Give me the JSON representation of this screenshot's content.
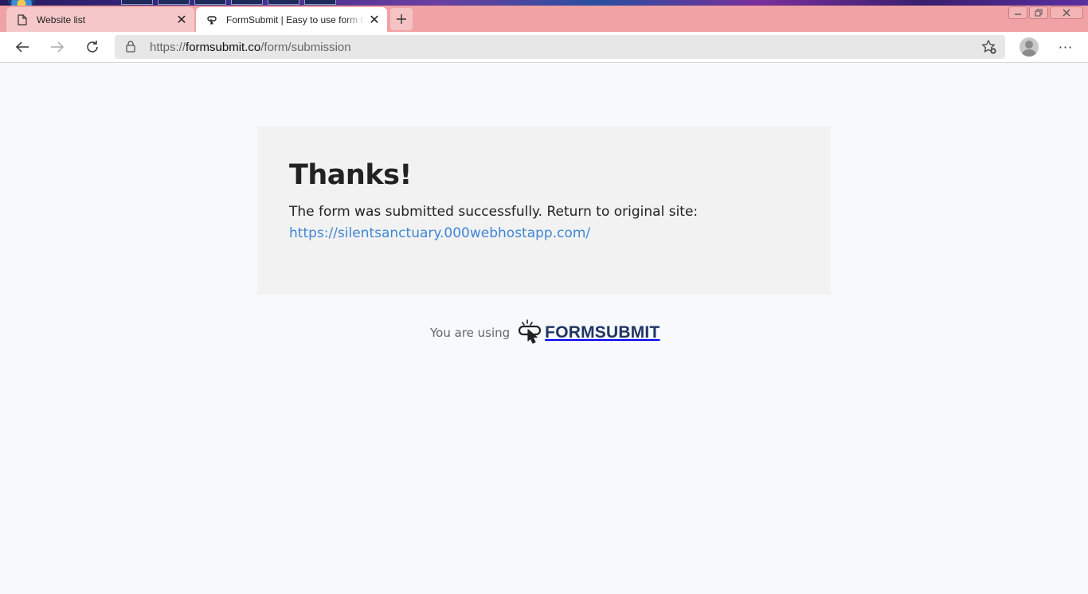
{
  "browser": {
    "tabs": [
      {
        "title": "Website list",
        "icon": "document-icon",
        "active": false
      },
      {
        "title": "FormSubmit | Easy to use form b",
        "icon": "formsubmit-favicon-icon",
        "active": true
      }
    ],
    "close_symbol": "✕",
    "address": {
      "scheme": "https://",
      "host": "formsubmit.co",
      "path": "/form/submission"
    },
    "more_symbol": "···"
  },
  "page": {
    "heading": "Thanks!",
    "message": "The form was submitted successfully. Return to original site:",
    "return_link": "https://silentsanctuary.000webhostapp.com/",
    "footer_prefix": "You are using",
    "brand": "FORMSUBMIT"
  },
  "colors": {
    "tabbar": "#f0a2a4",
    "link": "#3f86d4",
    "brand": "#1f3563"
  }
}
